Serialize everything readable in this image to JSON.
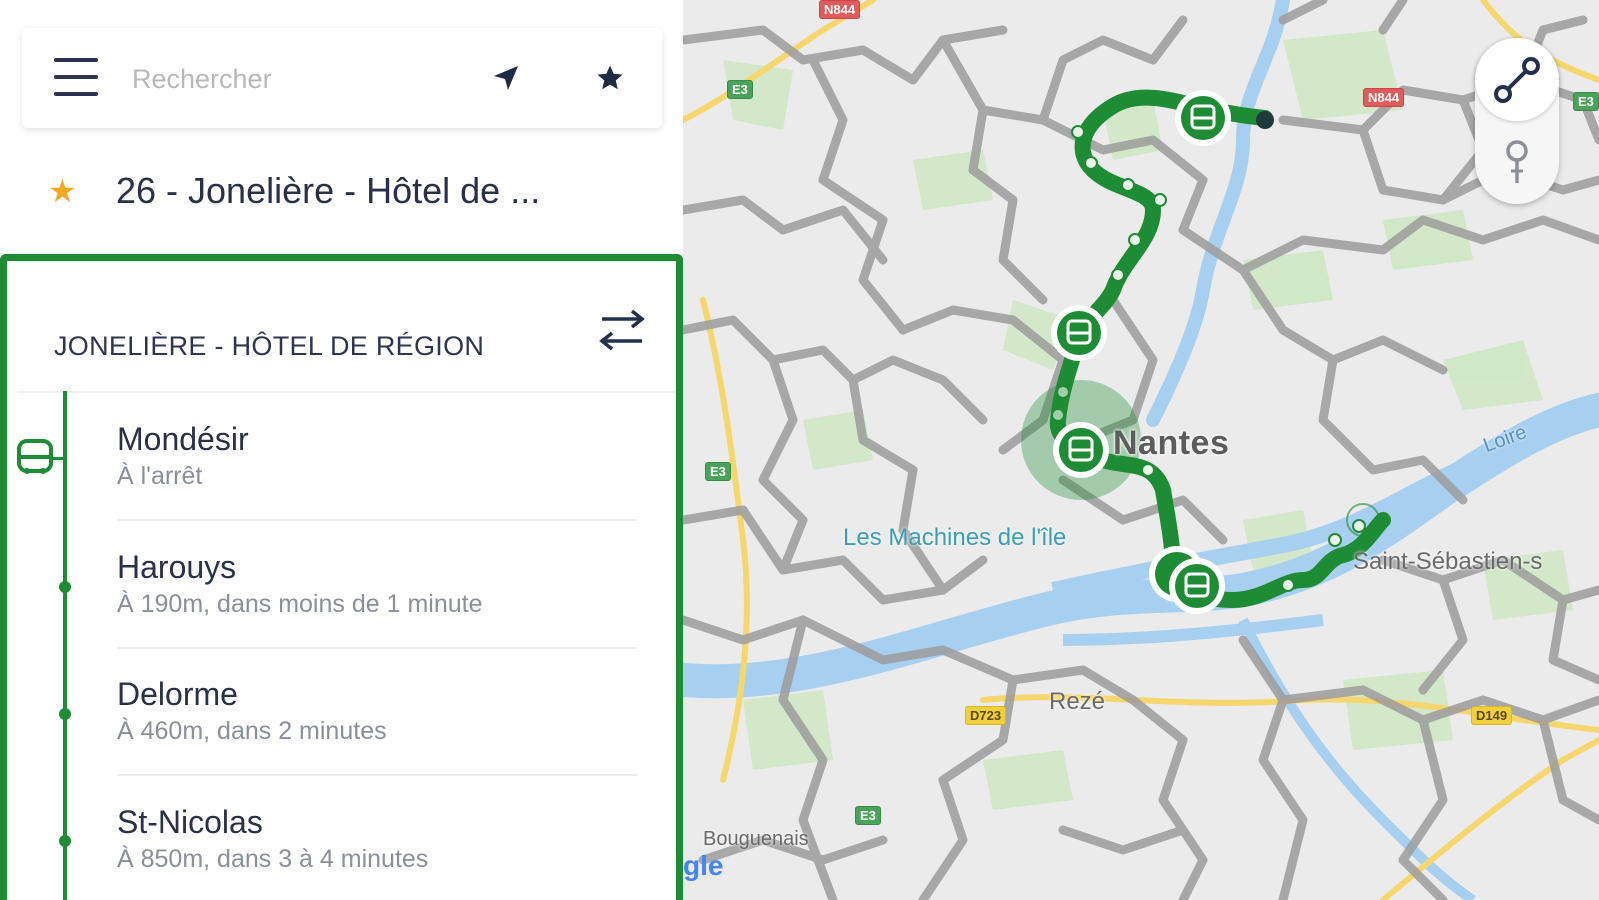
{
  "search": {
    "placeholder": "Rechercher"
  },
  "favorite": {
    "label": "26 - Jonelière - Hôtel de ..."
  },
  "line_card": {
    "direction": "JONELIÈRE - HÔTEL DE RÉGION",
    "accent_color": "#1e8c34",
    "stops": [
      {
        "name": "Mondésir",
        "info": "À l'arrêt"
      },
      {
        "name": "Harouys",
        "info": "À 190m, dans moins de 1 minute"
      },
      {
        "name": "Delorme",
        "info": "À 460m, dans 2 minutes"
      },
      {
        "name": "St-Nicolas",
        "info": "À 850m, dans 3 à 4 minutes"
      }
    ]
  },
  "map": {
    "city": "Nantes",
    "poi": "Les Machines de l'île",
    "towns": [
      "Rezé",
      "Saint-Sébastien-s",
      "Bouguenais"
    ],
    "river": "Loire",
    "road_shields": [
      "N844",
      "N844",
      "D723",
      "D149",
      "E3",
      "E3",
      "E3",
      "E3"
    ],
    "google_logo": "gle",
    "route_color": "#1e8c34"
  },
  "icons": {
    "menu": "hamburger-icon",
    "locate": "navigation-arrow-icon",
    "favorites": "star-icon",
    "swap": "swap-arrows-icon",
    "route_toggle": "route-line-icon",
    "stops_toggle": "pin-icon",
    "bus": "bus-icon"
  }
}
